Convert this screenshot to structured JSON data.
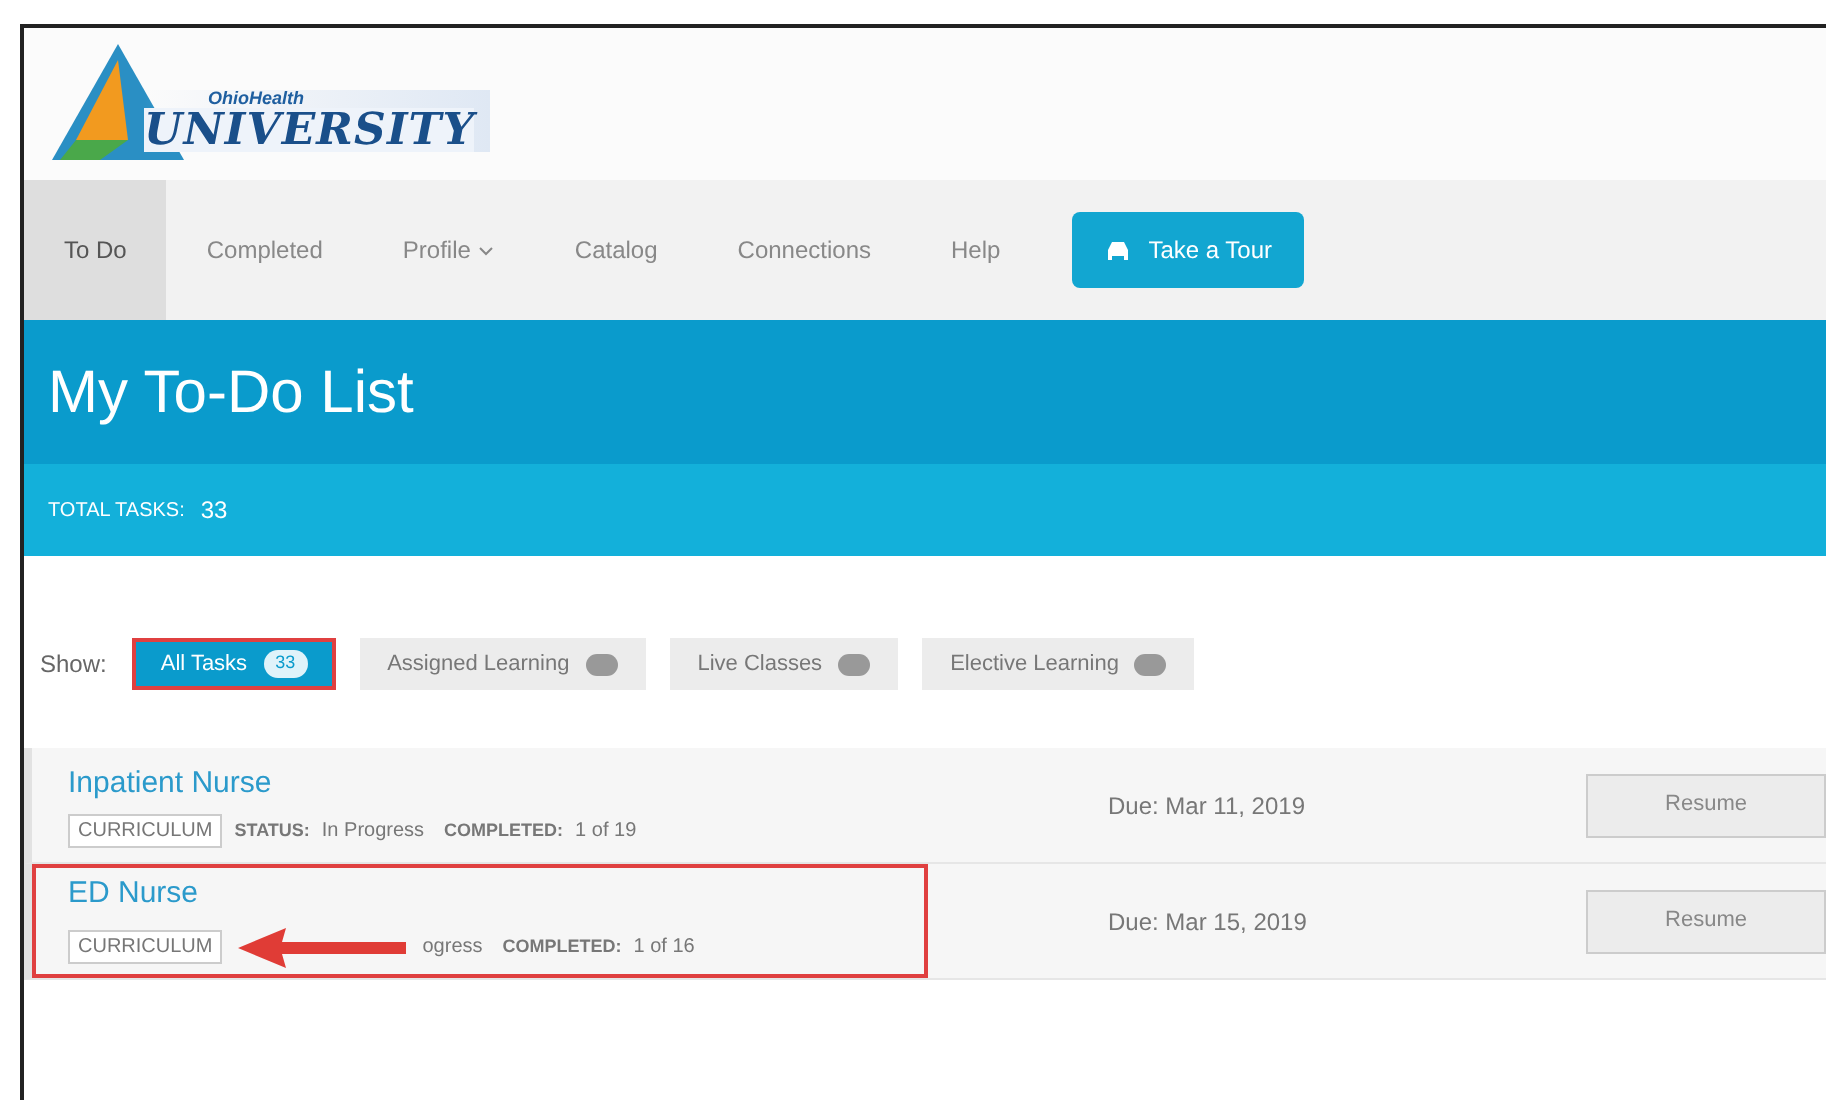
{
  "logo": {
    "small_text": "OhioHealth",
    "big_text": "UNIVERSITY"
  },
  "nav": [
    {
      "label": "To Do",
      "selected": true,
      "kind": "link",
      "caret": false
    },
    {
      "label": "Completed",
      "selected": false,
      "kind": "link",
      "caret": false
    },
    {
      "label": "Profile",
      "selected": false,
      "kind": "link",
      "caret": true
    },
    {
      "label": "Catalog",
      "selected": false,
      "kind": "link",
      "caret": false
    },
    {
      "label": "Connections",
      "selected": false,
      "kind": "link",
      "caret": false
    },
    {
      "label": "Help",
      "selected": false,
      "kind": "link",
      "caret": false
    },
    {
      "label": "Take a Tour",
      "kind": "tour"
    }
  ],
  "title": "My To-Do List",
  "total_tasks": {
    "label": "TOTAL TASKS:",
    "value": "33"
  },
  "filters": {
    "label": "Show:",
    "items": [
      {
        "label": "All Tasks",
        "count": "33",
        "selected": true,
        "highlighted": true
      },
      {
        "label": "Assigned Learning",
        "selected": false,
        "highlighted": false
      },
      {
        "label": "Live Classes",
        "selected": false,
        "highlighted": false
      },
      {
        "label": "Elective Learning",
        "selected": false,
        "highlighted": false
      }
    ]
  },
  "tasks": [
    {
      "title": "Inpatient Nurse",
      "type": "CURRICULUM",
      "status_label": "STATUS:",
      "status": "In Progress",
      "completed_label": "COMPLETED:",
      "completed": "1 of 19",
      "due": "Due: Mar 11, 2019",
      "action": "Resume",
      "highlighted": false,
      "arrow": false
    },
    {
      "title": "ED Nurse",
      "type": "CURRICULUM",
      "status": "ogress",
      "completed_label": "COMPLETED:",
      "completed": "1 of 16",
      "due": "Due: Mar 15, 2019",
      "action": "Resume",
      "highlighted": true,
      "arrow": true
    }
  ]
}
